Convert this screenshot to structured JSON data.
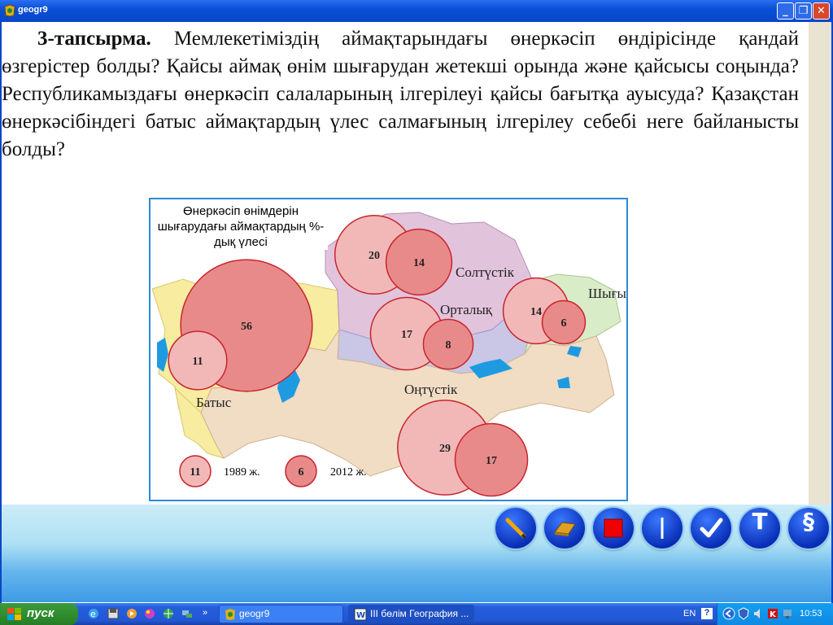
{
  "window": {
    "title": "geogr9",
    "min_label": "_",
    "max_label": "❐",
    "close_label": "✕"
  },
  "task": {
    "number": "3-тапсырма.",
    "text": " Мемлекетіміздің аймақтарындағы өнеркәсіп өндірісінде қандай өзгерістер болды? Қайсы аймақ өнім шығарудан жетекші орында және қайсысы соңында? Республикамыздағы өнеркәсіп салаларының ілгерілеуі қайсы бағытқа ауысуда? Қазақстан өнеркәсібіндегі батыс аймақтардың үлес салмағының ілгерілеу себебі неге байланысты болды?"
  },
  "map": {
    "legend_title": "Өнеркәсіп өнімдерін шығарудағы аймақтардың %-дық үлесі",
    "regions": {
      "north": "Солтүстік",
      "central": "Орталық",
      "east": "Шығыс",
      "south": "Оңтүстік",
      "west": "Батыс"
    },
    "legend": {
      "sample_1989": "11",
      "label_1989": "1989 ж.",
      "sample_2012": "6",
      "label_2012": "2012 ж."
    },
    "shares": {
      "west": {
        "y1989": "11",
        "y2012": "56"
      },
      "north": {
        "y1989": "20",
        "y2012": "14"
      },
      "central": {
        "y1989": "17",
        "y2012": "8"
      },
      "east": {
        "y1989": "14",
        "y2012": "6"
      },
      "south": {
        "y1989": "29",
        "y2012": "17"
      }
    },
    "colors": {
      "c1989": "#f2b8b8",
      "c2012": "#e98a8a",
      "stroke": "#c8242c"
    }
  },
  "toolbar": {
    "items": [
      "pen-tool",
      "eraser-tool",
      "color-tool",
      "line-tool",
      "check-tool",
      "text-tool",
      "section-tool"
    ],
    "text_label": "T",
    "section_label": "§"
  },
  "taskbar": {
    "start_label": "пуск",
    "tasks": [
      {
        "label": "geogr9"
      },
      {
        "label": "ІІІ бөлім География ..."
      }
    ],
    "lang": "EN",
    "help": "?",
    "clock": "10:53"
  }
}
